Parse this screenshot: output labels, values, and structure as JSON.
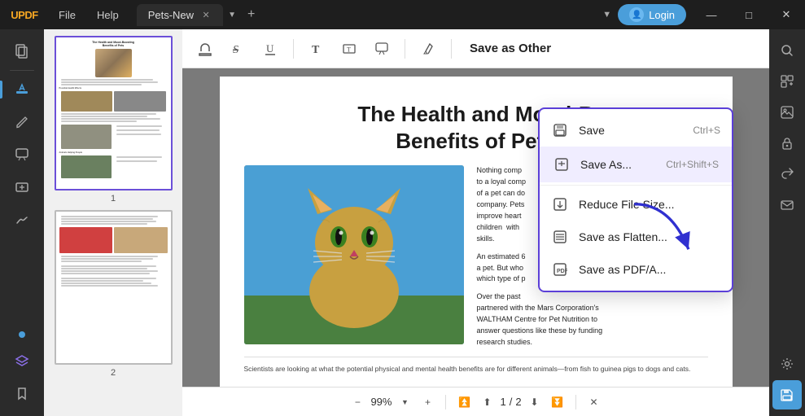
{
  "app": {
    "name": "UPDF",
    "logo_up": "UP",
    "logo_df": "DF"
  },
  "titlebar": {
    "menu": [
      "File",
      "Help"
    ],
    "tab_name": "Pets-New",
    "login_label": "Login",
    "win_min": "—",
    "win_max": "□",
    "win_close": "✕"
  },
  "toolbar": {
    "save_as_other_label": "Save as Other",
    "icons": [
      "stamp",
      "strikethrough",
      "underline",
      "text",
      "textbox",
      "comment",
      "highlight"
    ]
  },
  "pdf": {
    "heading_line1": "The Health and Mood-B",
    "heading_line2": "Benefits of Pets",
    "body_text1": "Nothing comp",
    "body_text2": "to a loyal comp",
    "body_text3": "of a pet can do",
    "body_text4": "company. Pets",
    "body_text5": "improve heart",
    "body_text6": "children  with",
    "body_text7": "skills.",
    "body_text8": "An estimated 6",
    "body_text9": "a pet. But who",
    "body_text10": "which type of p",
    "body_text11": "Over the past",
    "body_text12": "partnered with the Mars Corporation's",
    "body_text13": "WALTHAM Centre for Pet Nutrition to",
    "body_text14": "answer questions like these by funding",
    "body_text15": "research studies.",
    "footer_text": "Scientists are looking at what the potential physical and mental health benefits are for different animals—from fish to guinea pigs to dogs and cats."
  },
  "dropdown": {
    "title": "Save as Other",
    "items": [
      {
        "id": "save",
        "label": "Save",
        "shortcut": "Ctrl+S",
        "icon": "💾"
      },
      {
        "id": "save-as",
        "label": "Save As...",
        "shortcut": "Ctrl+Shift+S",
        "icon": "📄"
      },
      {
        "id": "reduce",
        "label": "Reduce File Size...",
        "shortcut": "",
        "icon": "📦"
      },
      {
        "id": "flatten",
        "label": "Save as Flatten...",
        "shortcut": "",
        "icon": "⬇"
      },
      {
        "id": "pdfa",
        "label": "Save as PDF/A...",
        "shortcut": "",
        "icon": "🅿"
      }
    ]
  },
  "bottom_bar": {
    "zoom_level": "99%",
    "page_current": "1",
    "page_separator": "/",
    "page_total": "2"
  },
  "right_sidebar": {
    "icons": [
      "search",
      "ocr",
      "edit-image",
      "lock",
      "share",
      "email",
      "settings",
      "save-active"
    ]
  },
  "thumbnails": [
    {
      "label": "1"
    },
    {
      "label": "2"
    }
  ]
}
